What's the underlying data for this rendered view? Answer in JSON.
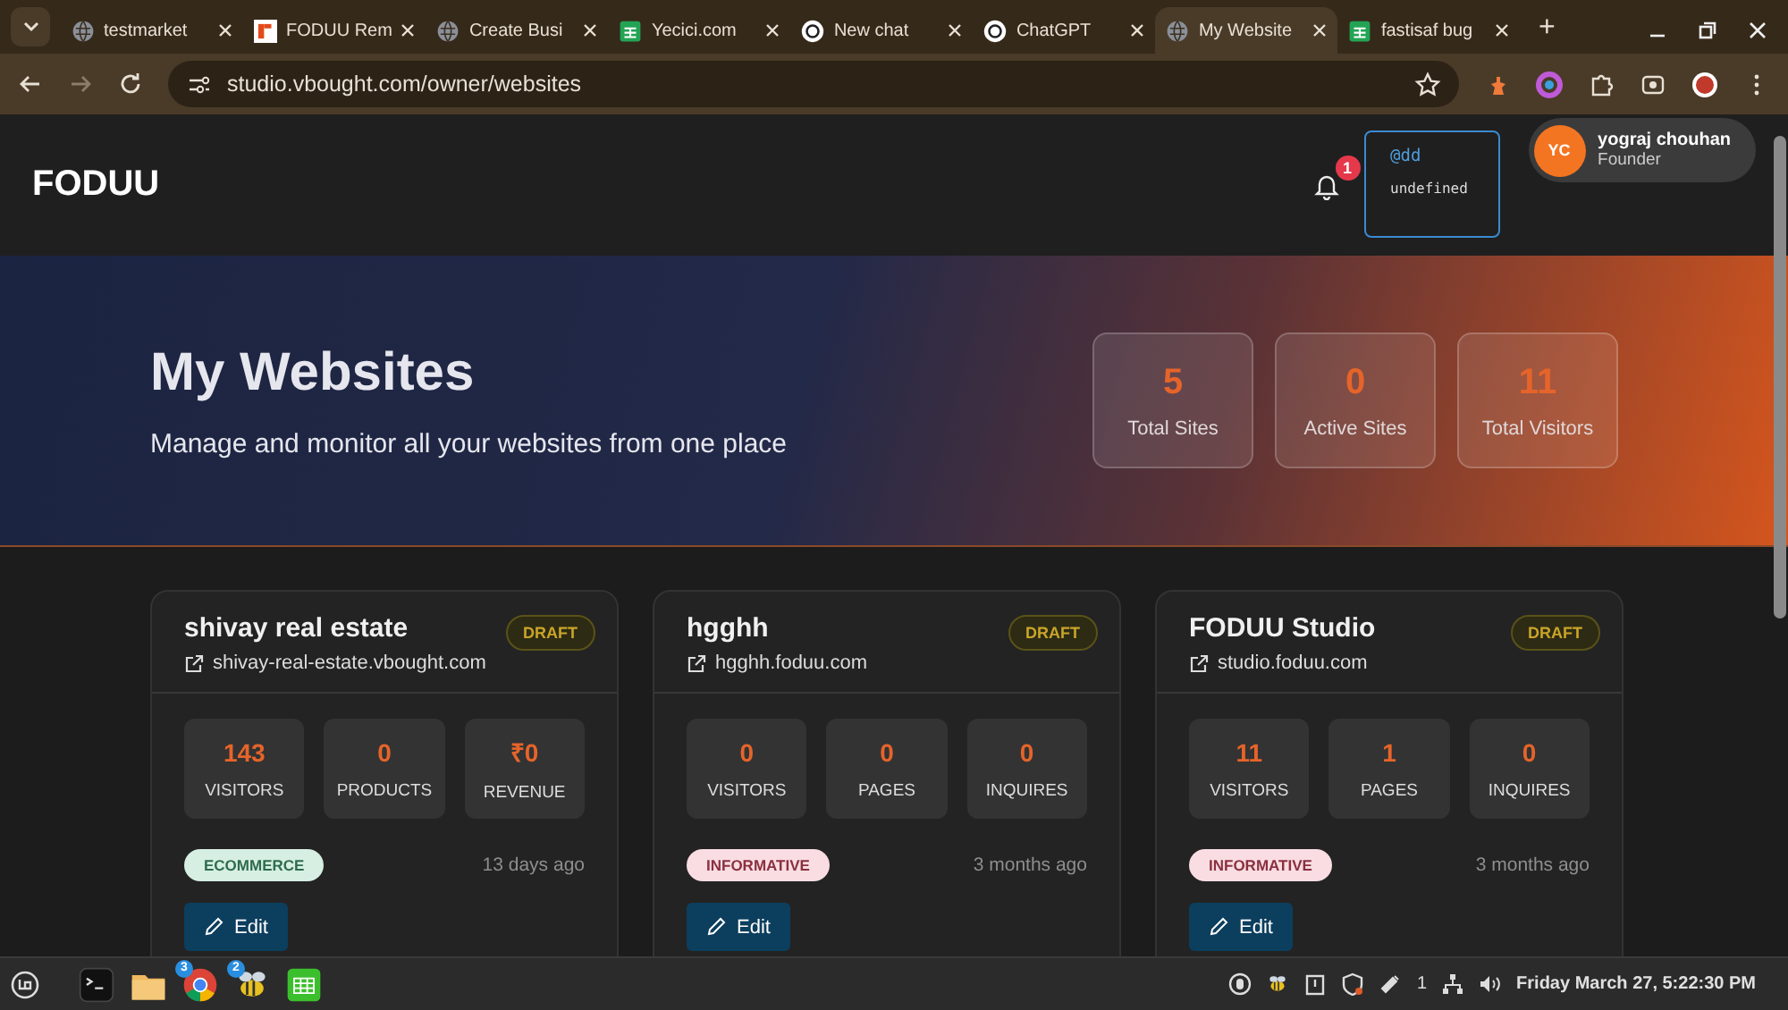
{
  "browser": {
    "tabs": [
      {
        "title": "testmarket",
        "kind": "globe",
        "selected": false
      },
      {
        "title": "FODUU Rem",
        "kind": "brand",
        "selected": false
      },
      {
        "title": "Create Busi",
        "kind": "globe",
        "selected": false
      },
      {
        "title": "Yecici.com",
        "kind": "sheet",
        "selected": false
      },
      {
        "title": "New chat",
        "kind": "chat",
        "selected": false
      },
      {
        "title": "ChatGPT",
        "kind": "chat",
        "selected": false
      },
      {
        "title": "My Website",
        "kind": "globe",
        "selected": true
      },
      {
        "title": "fastisaf bug",
        "kind": "sheet",
        "selected": false
      }
    ],
    "new_tab": "+",
    "url": "studio.vbought.com/owner/websites"
  },
  "header": {
    "logo": "FODUU",
    "notifications": "1",
    "popup": {
      "handle": "@dd",
      "text": "undefined"
    },
    "user": {
      "initials": "YC",
      "name": "yograj chouhan",
      "role": "Founder"
    }
  },
  "hero": {
    "title": "My Websites",
    "subtitle": "Manage and monitor all your websites from one place",
    "stats": [
      {
        "value": "5",
        "label": "Total Sites"
      },
      {
        "value": "0",
        "label": "Active Sites"
      },
      {
        "value": "11",
        "label": "Total Visitors"
      }
    ]
  },
  "sites": [
    {
      "name": "shivay real estate",
      "status": "DRAFT",
      "url": "shivay-real-estate.vbought.com",
      "metrics": [
        {
          "value": "143",
          "label": "VISITORS"
        },
        {
          "value": "0",
          "label": "PRODUCTS"
        },
        {
          "value": "₹0",
          "label": "REVENUE"
        }
      ],
      "category": "ECOMMERCE",
      "kind": "ecommerce",
      "updated": "13 days ago",
      "edit": "Edit"
    },
    {
      "name": "hgghh",
      "status": "DRAFT",
      "url": "hgghh.foduu.com",
      "metrics": [
        {
          "value": "0",
          "label": "VISITORS"
        },
        {
          "value": "0",
          "label": "PAGES"
        },
        {
          "value": "0",
          "label": "INQUIRES"
        }
      ],
      "category": "INFORMATIVE",
      "kind": "informative",
      "updated": "3 months ago",
      "edit": "Edit"
    },
    {
      "name": "FODUU Studio",
      "status": "DRAFT",
      "url": "studio.foduu.com",
      "metrics": [
        {
          "value": "11",
          "label": "VISITORS"
        },
        {
          "value": "1",
          "label": "PAGES"
        },
        {
          "value": "0",
          "label": "INQUIRES"
        }
      ],
      "category": "INFORMATIVE",
      "kind": "informative",
      "updated": "3 months ago",
      "edit": "Edit"
    }
  ],
  "taskbar": {
    "apps": [
      {
        "kind": "terminal"
      },
      {
        "kind": "files"
      },
      {
        "kind": "chrome",
        "badge": "3"
      },
      {
        "kind": "bee",
        "badge": "2"
      },
      {
        "kind": "sheet"
      }
    ],
    "tray_count": "1",
    "clock": "Friday March 27, 5:22:30 PM"
  }
}
